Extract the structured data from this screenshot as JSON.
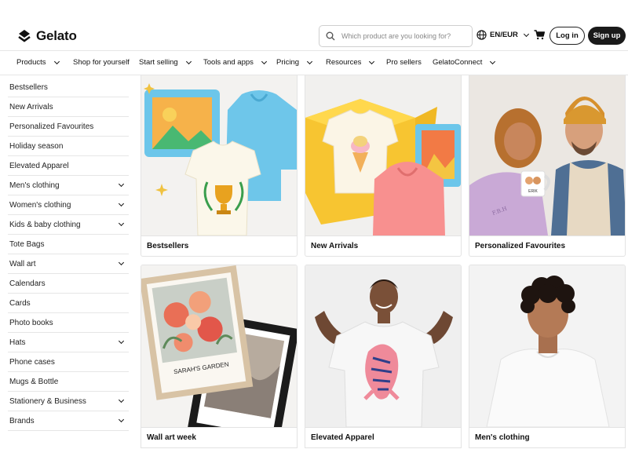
{
  "header": {
    "brand": "Gelato",
    "search_placeholder": "Which product are you looking for?",
    "language": "EN/EUR",
    "login_label": "Log in",
    "signup_label": "Sign up"
  },
  "nav": [
    {
      "label": "Products",
      "dropdown": true
    },
    {
      "label": "Shop for yourself",
      "dropdown": false
    },
    {
      "label": "Start selling",
      "dropdown": true
    },
    {
      "label": "Tools and apps",
      "dropdown": true
    },
    {
      "label": "Pricing",
      "dropdown": true
    },
    {
      "label": "Resources",
      "dropdown": true
    },
    {
      "label": "Pro sellers",
      "dropdown": false
    },
    {
      "label": "GelatoConnect",
      "dropdown": true
    }
  ],
  "sidebar": [
    {
      "label": "Bestsellers",
      "expandable": false
    },
    {
      "label": "New Arrivals",
      "expandable": false
    },
    {
      "label": "Personalized Favourites",
      "expandable": false
    },
    {
      "label": "Holiday season",
      "expandable": false
    },
    {
      "label": "Elevated Apparel",
      "expandable": false
    },
    {
      "label": "Men's clothing",
      "expandable": true
    },
    {
      "label": "Women's clothing",
      "expandable": true
    },
    {
      "label": "Kids & baby clothing",
      "expandable": true
    },
    {
      "label": "Tote Bags",
      "expandable": false
    },
    {
      "label": "Wall art",
      "expandable": true
    },
    {
      "label": "Calendars",
      "expandable": false
    },
    {
      "label": "Cards",
      "expandable": false
    },
    {
      "label": "Photo books",
      "expandable": false
    },
    {
      "label": "Hats",
      "expandable": true
    },
    {
      "label": "Phone cases",
      "expandable": false
    },
    {
      "label": "Mugs & Bottle",
      "expandable": false
    },
    {
      "label": "Stationery & Business",
      "expandable": true
    },
    {
      "label": "Brands",
      "expandable": true
    }
  ],
  "cards": [
    {
      "label": "Bestsellers"
    },
    {
      "label": "New Arrivals"
    },
    {
      "label": "Personalized Favourites"
    },
    {
      "label": "Wall art week",
      "print_title": "SARAH'S GARDEN"
    },
    {
      "label": "Elevated Apparel"
    },
    {
      "label": "Men's clothing"
    }
  ],
  "mug_text": "ERIK",
  "sleeve_text": "F.B.H",
  "colors": {
    "signup_bg": "#1a1a1a",
    "border": "#e3e3e3"
  }
}
